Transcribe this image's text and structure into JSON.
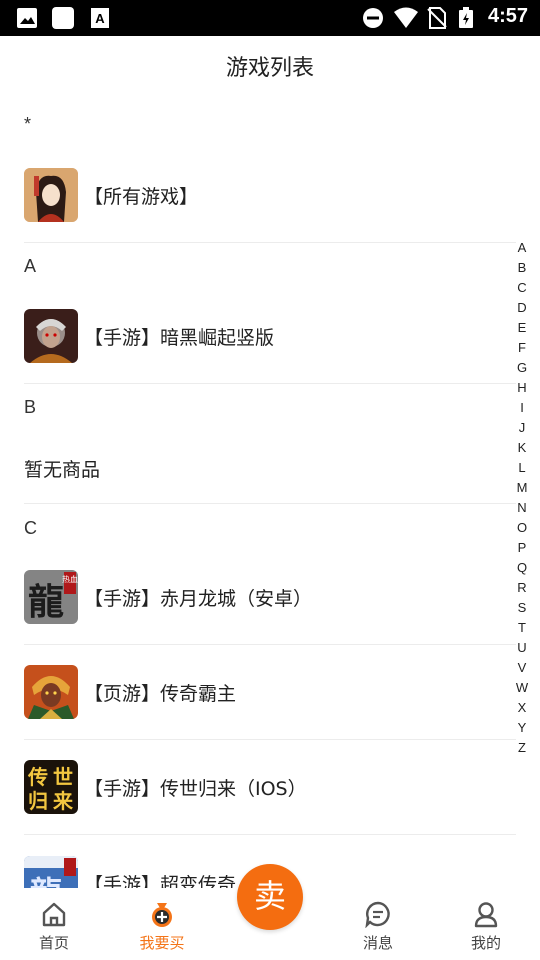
{
  "status_bar": {
    "time": "4:57",
    "icons": [
      "image-icon",
      "square-icon",
      "font-icon",
      "do-not-disturb-icon",
      "wifi-icon",
      "no-sim-icon",
      "battery-charging-icon"
    ]
  },
  "page": {
    "title": "游戏列表"
  },
  "sections": [
    {
      "letter": "*",
      "games": [
        {
          "name": "【所有游戏】",
          "thumb": "all-games-thumb"
        }
      ]
    },
    {
      "letter": "A",
      "games": [
        {
          "name": "【手游】暗黑崛起竖版",
          "thumb": "dark-rise-thumb"
        }
      ]
    },
    {
      "letter": "B",
      "empty": "暂无商品"
    },
    {
      "letter": "C",
      "games": [
        {
          "name": "【手游】赤月龙城（安卓）",
          "thumb": "chiyue-dragon-thumb",
          "thumb_text": "龍",
          "thumb_badge": "热血"
        },
        {
          "name": "【页游】传奇霸主",
          "thumb": "legend-overlord-thumb"
        },
        {
          "name": "【手游】传世归来（IOS）",
          "thumb": "chuanshi-return-thumb",
          "thumb_text": "传世归来"
        },
        {
          "name": "【手游】超变传奇（…）",
          "thumb": "super-legend-thumb",
          "thumb_text": "龍"
        }
      ]
    }
  ],
  "index_letters": [
    "A",
    "B",
    "C",
    "D",
    "E",
    "F",
    "G",
    "H",
    "I",
    "J",
    "K",
    "L",
    "M",
    "N",
    "O",
    "P",
    "Q",
    "R",
    "S",
    "T",
    "U",
    "V",
    "W",
    "X",
    "Y",
    "Z"
  ],
  "bottom_nav": {
    "home": "首页",
    "buy": "我要买",
    "sell": "卖",
    "messages": "消息",
    "mine": "我的"
  },
  "colors": {
    "accent": "#f47418",
    "sell_button": "#f46d10",
    "divider": "#ececec"
  }
}
